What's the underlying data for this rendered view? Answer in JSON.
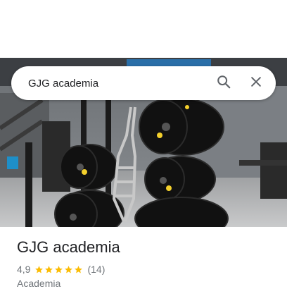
{
  "search": {
    "query": "GJG academia",
    "search_icon": "search-icon",
    "close_icon": "close-icon"
  },
  "place": {
    "title": "GJG academia",
    "rating_value": "4,9",
    "rating_stars": 5,
    "review_count": "(14)",
    "category": "Academia"
  },
  "colors": {
    "star": "#fbbc04",
    "text_primary": "#202124",
    "text_secondary": "#70757a"
  }
}
